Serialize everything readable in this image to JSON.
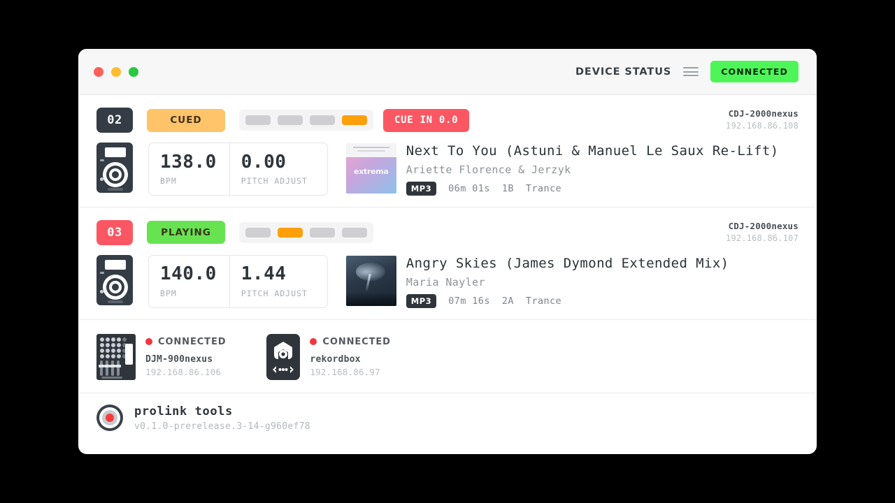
{
  "window": {
    "traffic_lights": [
      "close",
      "minimize",
      "maximize"
    ],
    "header": {
      "title": "DEVICE STATUS",
      "menu_icon": "hamburger-icon",
      "status_badge": "CONNECTED",
      "status_color": "#4ef558"
    }
  },
  "decks": [
    {
      "number": "02",
      "number_color": "#343c45",
      "state": "CUED",
      "state_color": "#ffc369",
      "beats": [
        false,
        false,
        false,
        true
      ],
      "beat_on_color": "#ff9f0a",
      "cue_text": "CUE IN 0.0",
      "cue_color": "#fb5763",
      "device_name": "CDJ-2000nexus",
      "device_ip": "192.168.86.108",
      "bpm_value": "138.0",
      "bpm_label": "BPM",
      "pitch_value": "0.00",
      "pitch_label": "PITCH ADJUST",
      "track": {
        "title": "Next To You (Astuni & Manuel Le Saux Re-Lift)",
        "artist": "Ariette Florence & Jerzyk",
        "format": "MP3",
        "duration": "06m 01s",
        "key": "1B",
        "genre": "Trance",
        "artwork_text": "extrema"
      }
    },
    {
      "number": "03",
      "number_color": "#fb5763",
      "state": "PLAYING",
      "state_color": "#67e352",
      "beats": [
        false,
        true,
        false,
        false
      ],
      "beat_on_color": "#ff9f0a",
      "cue_text": "",
      "cue_color": "",
      "device_name": "CDJ-2000nexus",
      "device_ip": "192.168.86.107",
      "bpm_value": "140.0",
      "bpm_label": "BPM",
      "pitch_value": "1.44",
      "pitch_label": "PITCH ADJUST",
      "track": {
        "title": "Angry Skies (James Dymond Extended Mix)",
        "artist": "Maria Nayler",
        "format": "MP3",
        "duration": "07m 16s",
        "key": "2A",
        "genre": "Trance",
        "artwork_text": ""
      }
    }
  ],
  "peripherals": [
    {
      "icon": "mixer-icon",
      "status": "CONNECTED",
      "status_color": "#f5333f",
      "name": "DJM-900nexus",
      "ip": "192.168.86.106"
    },
    {
      "icon": "rekordbox-icon",
      "status": "CONNECTED",
      "status_color": "#f5333f",
      "name": "rekordbox",
      "ip": "192.168.86.97"
    }
  ],
  "footer": {
    "logo": "prolink-logo-icon",
    "app_name": "prolink tools",
    "version": "v0.1.0-prerelease.3-14-g960ef78"
  }
}
